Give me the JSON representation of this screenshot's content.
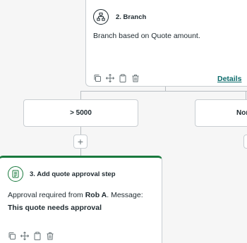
{
  "branch_step": {
    "title": "2. Branch",
    "description": "Branch based on Quote amount.",
    "details_label": "Details",
    "icon": "branch-icon"
  },
  "branches": [
    {
      "label": "> 5000"
    },
    {
      "label": "Nor"
    }
  ],
  "add_button": {
    "label": "+"
  },
  "approval_step": {
    "title": "3. Add quote approval step",
    "desc_prefix": "Approval required from ",
    "desc_approver": "Rob A",
    "desc_middle": ". Message: ",
    "desc_message": "This quote needs approval",
    "icon": "approval-icon",
    "accent_color": "#1a7a3e"
  },
  "action_icons": [
    "copy-icon",
    "move-icon",
    "clipboard-icon",
    "delete-icon"
  ],
  "colors": {
    "background": "#f6f6f6",
    "connector": "#b9bec2",
    "link": "#0b6b6b",
    "success": "#1a7a3e"
  }
}
